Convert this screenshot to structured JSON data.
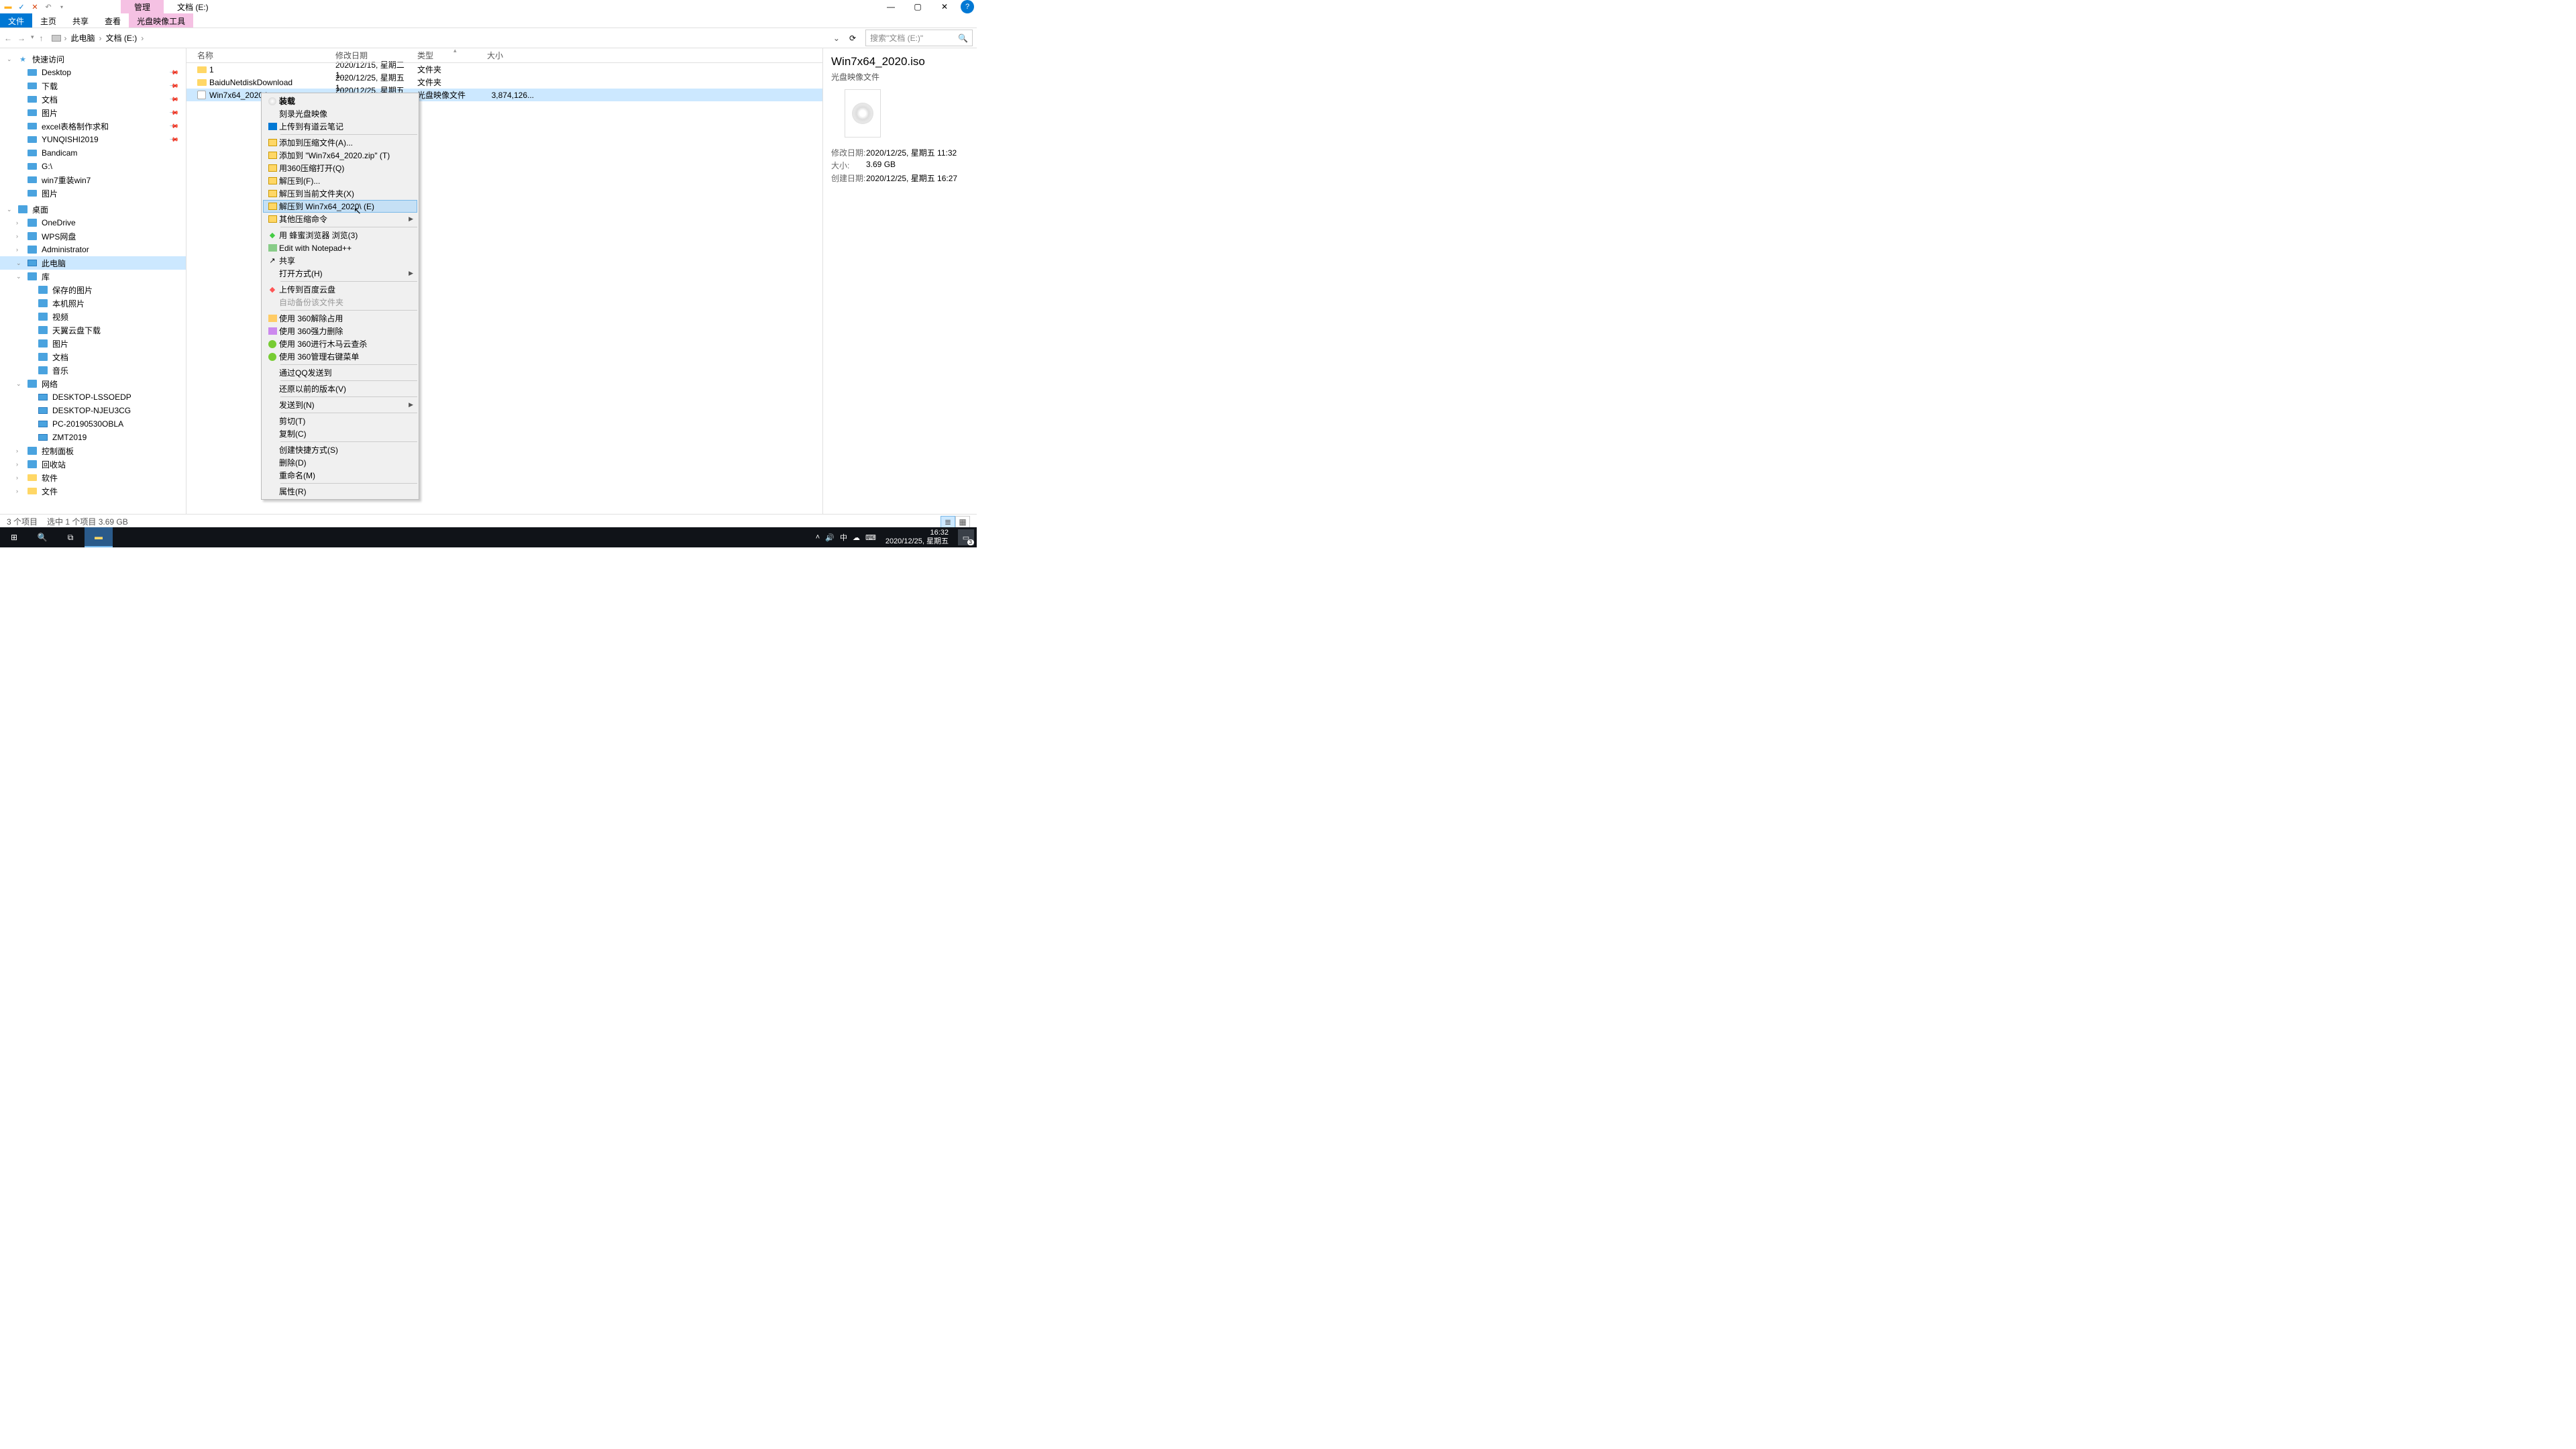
{
  "title_tabs": {
    "manage": "管理",
    "path": "文档 (E:)"
  },
  "ribbon": {
    "file": "文件",
    "home": "主页",
    "share": "共享",
    "view": "查看",
    "disc_tool": "光盘映像工具"
  },
  "window_controls": {
    "min": "—",
    "max": "▢",
    "close": "✕",
    "help": "?"
  },
  "nav": {
    "back": "←",
    "fwd": "→",
    "up": "↑"
  },
  "breadcrumbs": {
    "pc": "此电脑",
    "drive": "文档 (E:)"
  },
  "search": {
    "placeholder": "搜索\"文档 (E:)\"",
    "icon": "🔍"
  },
  "tree": {
    "quick": {
      "label": "快速访问",
      "items": [
        {
          "label": "Desktop",
          "pin": true
        },
        {
          "label": "下载",
          "pin": true
        },
        {
          "label": "文档",
          "pin": true
        },
        {
          "label": "图片",
          "pin": true
        },
        {
          "label": "excel表格制作求和",
          "pin": true
        },
        {
          "label": "YUNQISHI2019",
          "pin": true
        },
        {
          "label": "Bandicam"
        },
        {
          "label": "G:\\"
        },
        {
          "label": "win7重装win7"
        },
        {
          "label": "图片"
        }
      ]
    },
    "desktop": {
      "label": "桌面",
      "items": [
        {
          "label": "OneDrive",
          "ico": "cloud"
        },
        {
          "label": "WPS网盘",
          "ico": "cloud"
        },
        {
          "label": "Administrator",
          "ico": "user"
        },
        {
          "label": "此电脑",
          "ico": "pc",
          "selected": true
        },
        {
          "label": "库",
          "ico": "lib"
        },
        {
          "label": "保存的图片",
          "sub": true
        },
        {
          "label": "本机照片",
          "sub": true
        },
        {
          "label": "视频",
          "sub": true
        },
        {
          "label": "天翼云盘下载",
          "sub": true
        },
        {
          "label": "图片",
          "sub": true
        },
        {
          "label": "文档",
          "sub": true
        },
        {
          "label": "音乐",
          "sub": true
        },
        {
          "label": "网络",
          "ico": "net"
        },
        {
          "label": "DESKTOP-LSSOEDP",
          "sub": true,
          "ico": "pc"
        },
        {
          "label": "DESKTOP-NJEU3CG",
          "sub": true,
          "ico": "pc"
        },
        {
          "label": "PC-20190530OBLA",
          "sub": true,
          "ico": "pc"
        },
        {
          "label": "ZMT2019",
          "sub": true,
          "ico": "pc"
        },
        {
          "label": "控制面板",
          "ico": "cp"
        },
        {
          "label": "回收站",
          "ico": "bin"
        },
        {
          "label": "软件",
          "ico": "folder"
        },
        {
          "label": "文件",
          "ico": "folder"
        }
      ]
    }
  },
  "columns": {
    "name": "名称",
    "date": "修改日期",
    "type": "类型",
    "size": "大小"
  },
  "files": [
    {
      "name": "1",
      "date": "2020/12/15, 星期二 1...",
      "type": "文件夹",
      "size": "",
      "ico": "folder"
    },
    {
      "name": "BaiduNetdiskDownload",
      "date": "2020/12/25, 星期五 1...",
      "type": "文件夹",
      "size": "",
      "ico": "folder"
    },
    {
      "name": "Win7x64_2020.iso",
      "date": "2020/12/25, 星期五 1...",
      "type": "光盘映像文件",
      "size": "3,874,126...",
      "ico": "disc",
      "selected": true
    }
  ],
  "details": {
    "title": "Win7x64_2020.iso",
    "sub": "光盘映像文件",
    "rows": [
      {
        "l": "修改日期:",
        "v": "2020/12/25, 星期五 11:32"
      },
      {
        "l": "大小:",
        "v": "3.69 GB"
      },
      {
        "l": "创建日期:",
        "v": "2020/12/25, 星期五 16:27"
      }
    ]
  },
  "status": {
    "count": "3 个项目",
    "sel": "选中 1 个项目  3.69 GB"
  },
  "ctx": {
    "groups": [
      [
        {
          "l": "装载",
          "bold": true,
          "ico": "disc"
        },
        {
          "l": "刻录光盘映像"
        },
        {
          "l": "上传到有道云笔记",
          "ico": "blue"
        }
      ],
      [
        {
          "l": "添加到压缩文件(A)...",
          "ico": "zip"
        },
        {
          "l": "添加到 \"Win7x64_2020.zip\" (T)",
          "ico": "zip"
        },
        {
          "l": "用360压缩打开(Q)",
          "ico": "zip"
        },
        {
          "l": "解压到(F)...",
          "ico": "zip"
        },
        {
          "l": "解压到当前文件夹(X)",
          "ico": "zip"
        },
        {
          "l": "解压到 Win7x64_2020\\ (E)",
          "ico": "zip",
          "hover": true
        },
        {
          "l": "其他压缩命令",
          "ico": "zip",
          "arrow": true
        }
      ],
      [
        {
          "l": "用 蜂蜜浏览器 浏览(3)",
          "ico": "green"
        },
        {
          "l": "Edit with Notepad++",
          "ico": "npp"
        },
        {
          "l": "共享",
          "ico": "share"
        },
        {
          "l": "打开方式(H)",
          "arrow": true
        }
      ],
      [
        {
          "l": "上传到百度云盘",
          "ico": "baidu"
        },
        {
          "l": "自动备份该文件夹",
          "disabled": true
        }
      ],
      [
        {
          "l": "使用 360解除占用",
          "ico": "y360"
        },
        {
          "l": "使用 360强力删除",
          "ico": "p360"
        },
        {
          "l": "使用 360进行木马云查杀",
          "ico": "g360"
        },
        {
          "l": "使用 360管理右键菜单",
          "ico": "g360"
        }
      ],
      [
        {
          "l": "通过QQ发送到"
        }
      ],
      [
        {
          "l": "还原以前的版本(V)"
        }
      ],
      [
        {
          "l": "发送到(N)",
          "arrow": true
        }
      ],
      [
        {
          "l": "剪切(T)"
        },
        {
          "l": "复制(C)"
        }
      ],
      [
        {
          "l": "创建快捷方式(S)"
        },
        {
          "l": "删除(D)"
        },
        {
          "l": "重命名(M)"
        }
      ],
      [
        {
          "l": "属性(R)"
        }
      ]
    ]
  },
  "taskbar": {
    "tray": {
      "ime": "中",
      "time": "16:32",
      "date": "2020/12/25, 星期五",
      "notif": "3"
    }
  }
}
